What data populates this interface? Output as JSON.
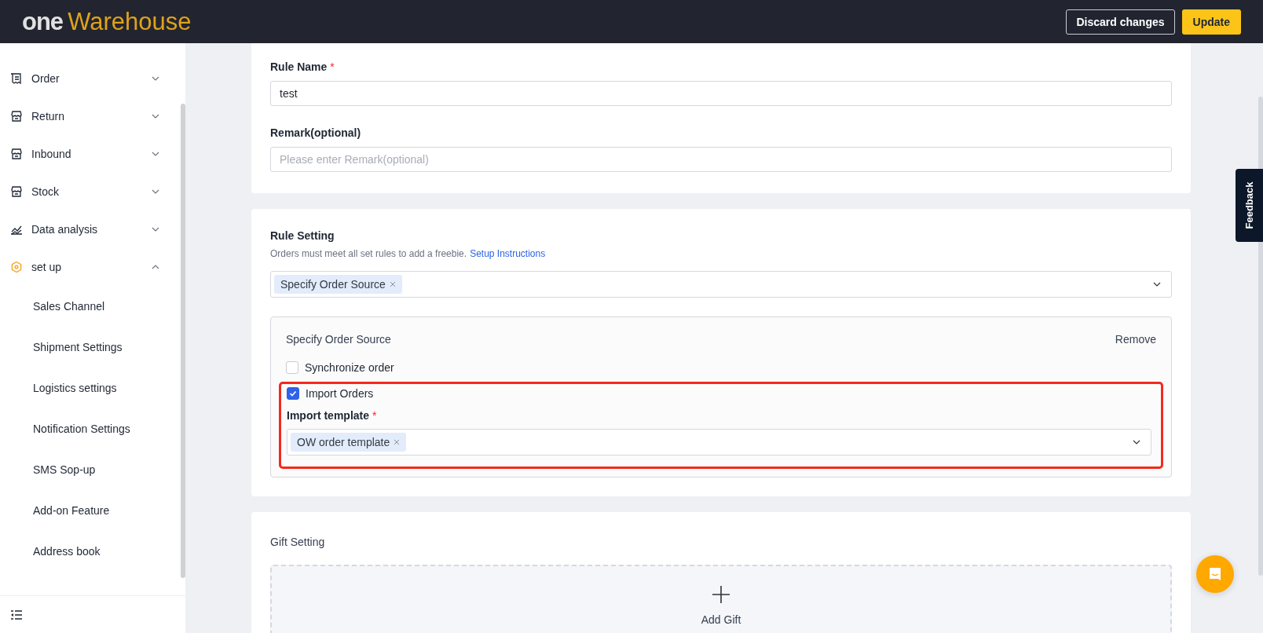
{
  "header": {
    "logo": {
      "mark": "one",
      "name": "Warehouse"
    },
    "buttons": [
      {
        "label": "Discard changes",
        "kind": "outline"
      },
      {
        "label": "Update",
        "kind": "primary"
      }
    ]
  },
  "sidebar": {
    "items": [
      {
        "label": "Order",
        "expanded": false
      },
      {
        "label": "Return",
        "expanded": false
      },
      {
        "label": "Inbound",
        "expanded": false
      },
      {
        "label": "Stock",
        "expanded": false
      },
      {
        "label": "Data analysis",
        "expanded": false
      },
      {
        "label": "set up",
        "expanded": true,
        "children": [
          {
            "label": "Sales Channel"
          },
          {
            "label": "Shipment Settings"
          },
          {
            "label": "Logistics settings"
          },
          {
            "label": "Notification Settings"
          },
          {
            "label": "SMS Sop-up"
          },
          {
            "label": "Add-on Feature"
          },
          {
            "label": "Address book"
          }
        ]
      }
    ]
  },
  "basic": {
    "rule_name": {
      "label": "Rule Name",
      "required_mark": "*",
      "value": "test"
    },
    "remark": {
      "label": "Remark(optional)",
      "placeholder": "Please enter Remark(optional)"
    }
  },
  "rule_setting": {
    "title": "Rule Setting",
    "hint": "Orders must meet all set rules to add a freebie.",
    "link": "Setup Instructions",
    "tags": [
      "Specify Order Source"
    ],
    "panel": {
      "title": "Specify Order Source",
      "remove": "Remove",
      "options": [
        {
          "label": "Synchronize order",
          "checked": false
        },
        {
          "label": "Import Orders",
          "checked": true
        }
      ],
      "template": {
        "label": "Import template",
        "required_mark": "*",
        "tags": [
          "OW order template"
        ]
      }
    }
  },
  "gift_setting": {
    "title": "Gift Setting",
    "add": "Add Gift"
  },
  "feedback": "Feedback"
}
